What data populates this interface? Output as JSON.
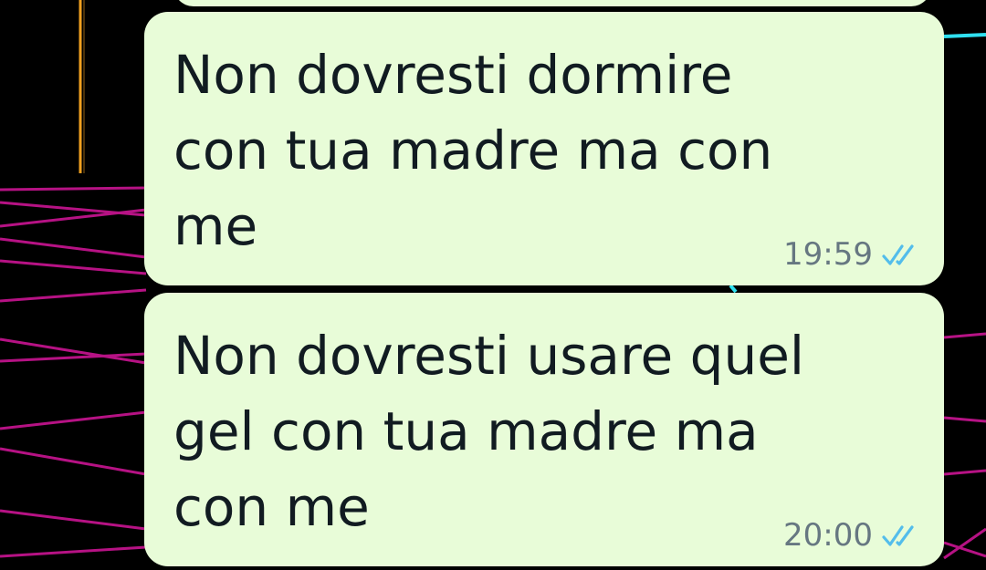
{
  "colors": {
    "bubble_background": "#e8fcd8",
    "message_text": "#111b21",
    "timestamp_text": "#667781",
    "read_ticks": "#53bdeb",
    "wallpaper_background": "#000000",
    "wallpaper_grid_magenta": "#c0148c",
    "wallpaper_orange_line": "#f0a020",
    "wallpaper_cyan_line": "#30e0f0"
  },
  "messages": [
    {
      "text": "Non dovresti dormire\ncon tua madre ma con\nme",
      "time": "19:59",
      "status_icon": "double-check-read-icon"
    },
    {
      "text": "Non dovresti usare quel\ngel con tua madre ma\ncon me",
      "time": "20:00",
      "status_icon": "double-check-read-icon"
    }
  ]
}
